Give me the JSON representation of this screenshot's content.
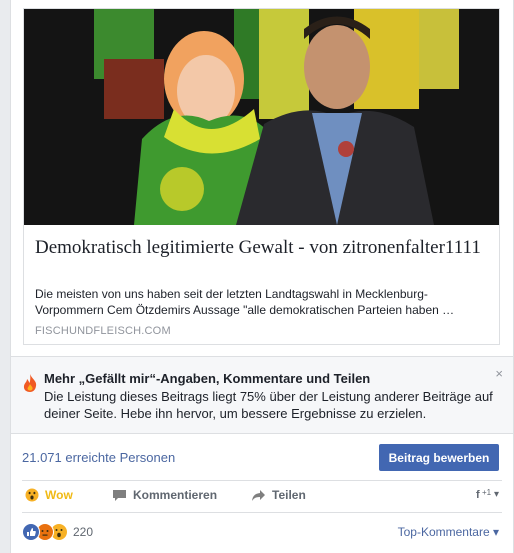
{
  "link_preview": {
    "title": "Demokratisch legitimierte Gewalt - von zitronenfalter1111",
    "description": "Die meisten von uns haben seit der letzten Landtagswahl in Mecklenburg-Vorpommern Cem Ötzdemirs Aussage \"alle demokratischen Parteien haben …",
    "domain": "FISCHUNDFLEISCH.COM",
    "image_icon": "photo-two-politicians"
  },
  "tip": {
    "icon": "flame-icon",
    "title": "Mehr „Gefällt mir“-Angaben, Kommentare und Teilen",
    "body": "Die Leistung dieses Beitrags liegt 75% über der Leistung anderer Beiträge auf deiner Seite. Hebe ihn hervor, um bessere Ergebnisse zu erzielen.",
    "close_label": "×"
  },
  "promotion": {
    "reach_text": "21.071 erreichte Personen",
    "button_label": "Beitrag bewerben"
  },
  "actions": {
    "wow_label": "Wow",
    "comment_label": "Kommentieren",
    "share_label": "Teilen",
    "menu_label": "▾"
  },
  "reactions": {
    "count": "220",
    "sort_label": "Top-Kommentare ▾"
  },
  "colors": {
    "accent": "#4267b2",
    "link": "#4b67a1",
    "wow": "#f0ba15",
    "background": "#e9ebee"
  }
}
